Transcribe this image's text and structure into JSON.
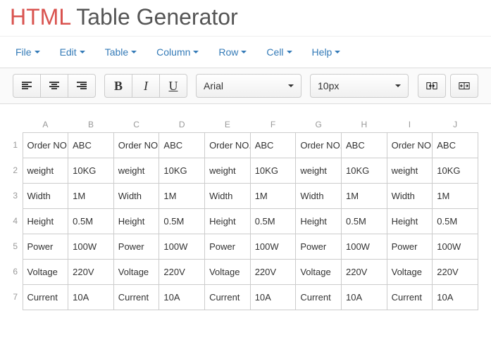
{
  "title": {
    "accent": "HTML",
    "rest": " Table Generator"
  },
  "menubar": [
    "File",
    "Edit",
    "Table",
    "Column",
    "Row",
    "Cell",
    "Help"
  ],
  "toolbar": {
    "font": "Arial",
    "size": "10px"
  },
  "columns": [
    "A",
    "B",
    "C",
    "D",
    "E",
    "F",
    "G",
    "H",
    "I",
    "J"
  ],
  "rows": [
    [
      "Order NO.",
      "ABC",
      "Order NO.",
      "ABC",
      "Order NO.",
      "ABC",
      "Order NO.",
      "ABC",
      "Order NO.",
      "ABC"
    ],
    [
      "weight",
      "10KG",
      "weight",
      "10KG",
      "weight",
      "10KG",
      "weight",
      "10KG",
      "weight",
      "10KG"
    ],
    [
      "Width",
      "1M",
      "Width",
      "1M",
      "Width",
      "1M",
      "Width",
      "1M",
      "Width",
      "1M"
    ],
    [
      "Height",
      "0.5M",
      "Height",
      "0.5M",
      "Height",
      "0.5M",
      "Height",
      "0.5M",
      "Height",
      "0.5M"
    ],
    [
      "Power",
      "100W",
      "Power",
      "100W",
      "Power",
      "100W",
      "Power",
      "100W",
      "Power",
      "100W"
    ],
    [
      "Voltage",
      "220V",
      "Voltage",
      "220V",
      "Voltage",
      "220V",
      "Voltage",
      "220V",
      "Voltage",
      "220V"
    ],
    [
      "Current",
      "10A",
      "Current",
      "10A",
      "Current",
      "10A",
      "Current",
      "10A",
      "Current",
      "10A"
    ]
  ]
}
